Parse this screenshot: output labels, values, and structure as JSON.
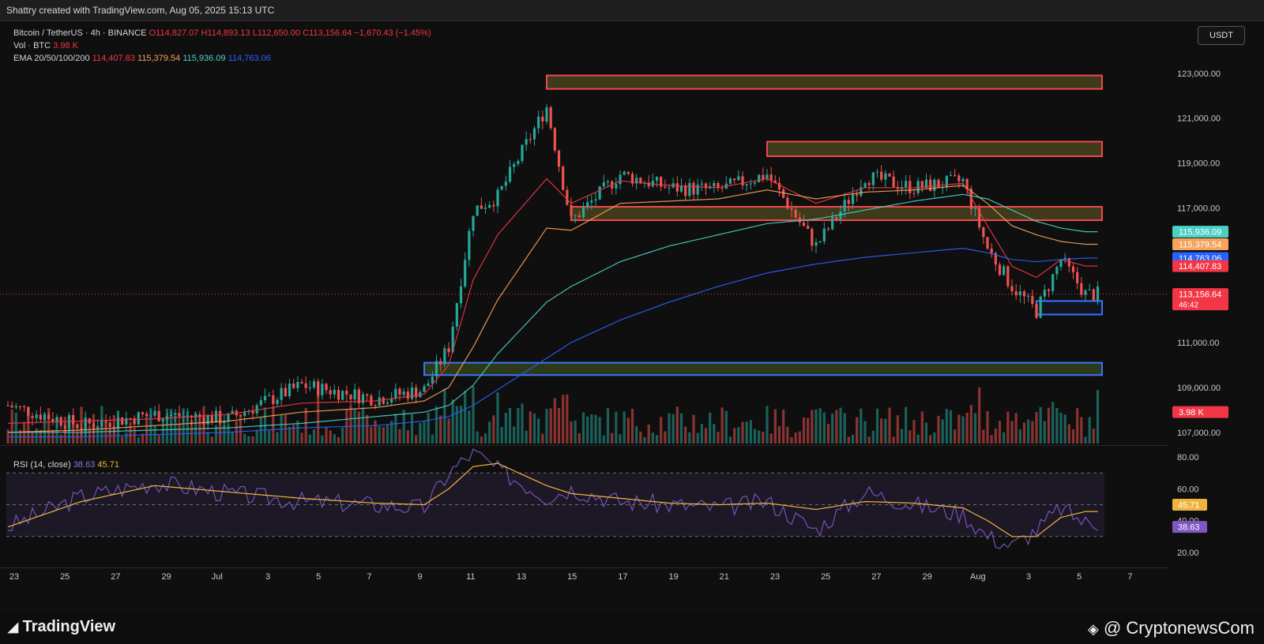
{
  "header": {
    "caption": "Shattry created with TradingView.com, Aug 05, 2025 15:13 UTC"
  },
  "legend": {
    "symbol": "Bitcoin / TetherUS · 4h · BINANCE",
    "open": "O114,827.07",
    "high": "H114,893.13",
    "low": "L112,650.00",
    "close": "C113,156.64",
    "change": "−1,670.43 (−1.45%)",
    "vol_label": "Vol · BTC",
    "vol_value": "3.98 K",
    "ema_label": "EMA 20/50/100/200",
    "ema_values": [
      "114,407.83",
      "115,379.54",
      "115,936.09",
      "114,763.06"
    ]
  },
  "currency_button": "USDT",
  "rsi_legend": {
    "label": "RSI (14, close)",
    "rsi": "38.63",
    "ma": "45.71"
  },
  "footer": {
    "tv_logo": "TradingView",
    "cn_logo": "@ CryptonewsCom"
  },
  "colors": {
    "up": "#26a69a",
    "down": "#ef5350",
    "ema20": "#f23645",
    "ema50": "#f7a35c",
    "ema100": "#4dd0c4",
    "ema200": "#2962ff",
    "rsi": "#7e57c2",
    "rsi_ma": "#f0b43c"
  },
  "chart_data": {
    "type": "candlestick",
    "price_axis": {
      "ticks": [
        "123,000.00",
        "121,000.00",
        "119,000.00",
        "117,000.00",
        "111,000.00",
        "109,000.00",
        "107,000.00"
      ],
      "range": [
        106500,
        123800
      ]
    },
    "time_axis": {
      "labels": [
        "23",
        "25",
        "27",
        "29",
        "Jul",
        "3",
        "5",
        "7",
        "9",
        "11",
        "13",
        "15",
        "17",
        "19",
        "21",
        "23",
        "25",
        "27",
        "29",
        "Aug",
        "3",
        "5",
        "7"
      ]
    },
    "price_labels": [
      {
        "value": "115,936.09",
        "color": "#4dd0c4",
        "price": 115936
      },
      {
        "value": "115,379.54",
        "color": "#f7a35c",
        "price": 115380
      },
      {
        "value": "114,763.06",
        "color": "#2962ff",
        "price": 114763
      },
      {
        "value": "114,407.83",
        "color": "#f23645",
        "price": 114408
      },
      {
        "value": "113,156.64",
        "sub": "46:42",
        "color": "#f23645",
        "price": 113157
      },
      {
        "value": "3.98 K",
        "color": "#f23645",
        "price": 107900
      }
    ],
    "zones": [
      {
        "kind": "resistance",
        "price_low": 122300,
        "price_high": 122900,
        "from": "Jul 14",
        "to": "Aug 5"
      },
      {
        "kind": "resistance",
        "price_low": 119300,
        "price_high": 119950,
        "from": "Jul 23",
        "to": "Aug 5"
      },
      {
        "kind": "resistance",
        "price_low": 116450,
        "price_high": 117050,
        "from": "Jul 15",
        "to": "Aug 5"
      },
      {
        "kind": "support",
        "price_low": 112250,
        "price_high": 112850,
        "from": "Aug 3",
        "to": "Aug 5"
      },
      {
        "kind": "support",
        "price_low": 109550,
        "price_high": 110100,
        "from": "Jul 9",
        "to": "Aug 5"
      }
    ],
    "price_path": {
      "dates": [
        "Jun 22",
        "Jun 25",
        "Jun 28",
        "Jul 1",
        "Jul 4",
        "Jul 7",
        "Jul 9",
        "Jul 10",
        "Jul 11",
        "Jul 12",
        "Jul 14",
        "Jul 15",
        "Jul 17",
        "Jul 19",
        "Jul 21",
        "Jul 23",
        "Jul 25",
        "Jul 27",
        "Jul 29",
        "Jul 31",
        "Aug 1",
        "Aug 2",
        "Aug 3",
        "Aug 4",
        "Aug 5"
      ],
      "close": [
        108200,
        107300,
        107800,
        107600,
        109100,
        108500,
        108900,
        110800,
        116900,
        117500,
        121500,
        116400,
        118500,
        117900,
        117800,
        118500,
        115300,
        118400,
        117900,
        118200,
        115200,
        113500,
        112400,
        114700,
        113157
      ]
    },
    "ema": {
      "ema20": [
        107400,
        107500,
        107600,
        107800,
        108300,
        108400,
        108700,
        110000,
        113800,
        115800,
        118300,
        117200,
        118200,
        118000,
        117900,
        118300,
        117200,
        117900,
        117900,
        118100,
        116200,
        114400,
        113900,
        114700,
        114408
      ],
      "ema50": [
        107000,
        107100,
        107300,
        107500,
        107900,
        108100,
        108400,
        109000,
        110800,
        112900,
        116100,
        116000,
        117200,
        117300,
        117400,
        117800,
        117400,
        117700,
        117800,
        118000,
        117200,
        116200,
        115800,
        115500,
        115380
      ],
      "ema100": [
        107000,
        107000,
        107100,
        107200,
        107400,
        107700,
        107900,
        108200,
        109100,
        110500,
        112800,
        113500,
        114600,
        115300,
        115800,
        116300,
        116500,
        116900,
        117300,
        117600,
        117400,
        116900,
        116400,
        116100,
        115936
      ],
      "ema200": [
        106800,
        106800,
        106900,
        107000,
        107200,
        107300,
        107500,
        107700,
        108200,
        108900,
        110300,
        111000,
        112000,
        112800,
        113500,
        114100,
        114500,
        114800,
        115000,
        115200,
        115000,
        114700,
        114600,
        114700,
        114763
      ]
    },
    "rsi": {
      "axis_ticks": [
        "80.00",
        "60.00",
        "40.00",
        "20.00"
      ],
      "bands": [
        70,
        50,
        30
      ],
      "rsi_path": [
        36,
        55,
        64,
        57,
        52,
        50,
        48,
        70,
        83,
        72,
        55,
        60,
        52,
        50,
        48,
        52,
        34,
        58,
        50,
        44,
        30,
        24,
        34,
        48,
        38.63
      ],
      "ma_path": [
        36,
        52,
        62,
        58,
        54,
        51,
        50,
        60,
        74,
        76,
        62,
        57,
        54,
        51,
        50,
        51,
        47,
        52,
        51,
        48,
        40,
        30,
        30,
        42,
        45.71
      ],
      "label_values": [
        "45.71",
        "38.63"
      ]
    }
  }
}
